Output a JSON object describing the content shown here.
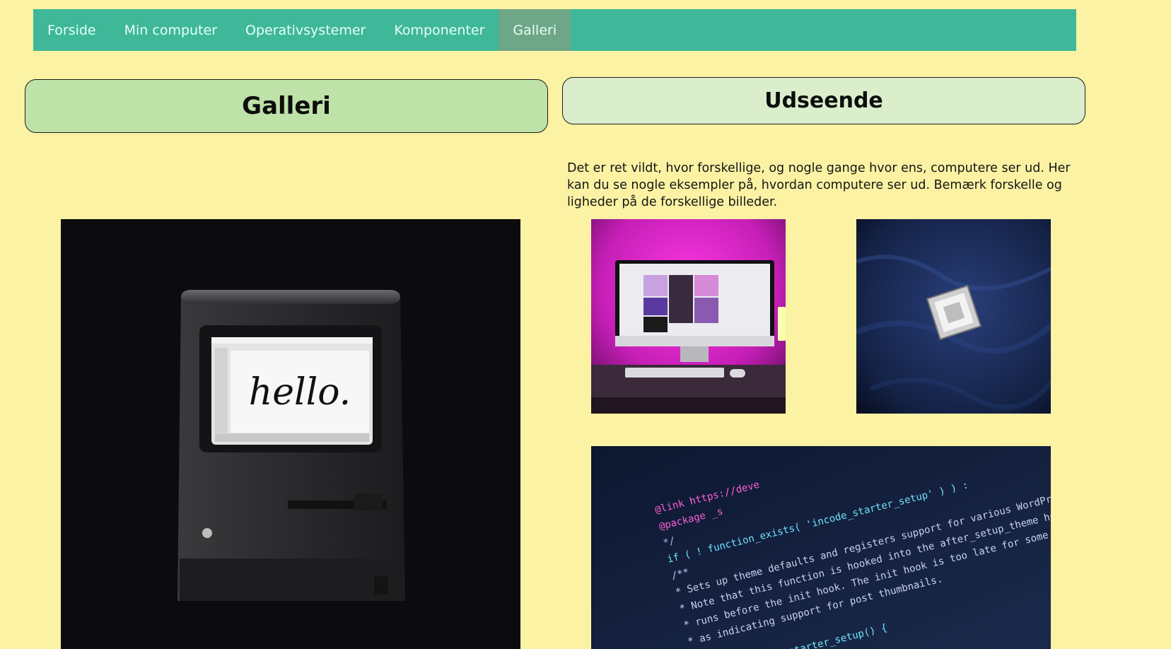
{
  "nav": {
    "items": [
      {
        "label": "Forside",
        "active": false
      },
      {
        "label": "Min computer",
        "active": false
      },
      {
        "label": "Operativsystemer",
        "active": false
      },
      {
        "label": "Komponenter",
        "active": false
      },
      {
        "label": "Galleri",
        "active": true
      }
    ]
  },
  "left_panel": {
    "title": "Galleri"
  },
  "right_panel": {
    "title": "Udseende",
    "intro": "Det er ret vildt, hvor forskellige, og nogle gange hvor ens, computere ser ud. Her kan du se nogle eksempler på, hvordan computere ser ud. Bemærk forskelle og ligheder på de forskellige billeder."
  },
  "gallery": {
    "mac_screen_text": "hello.",
    "code_lines": [
      "@link https://deve",
      "@package _s",
      "*/",
      "if ( ! function_exists( 'incode_starter_setup' ) ) :",
      "/**",
      " * Sets up theme defaults and registers support for various WordPress fe",
      " * Note that this function is hooked into the after_setup_theme hook, which",
      " * runs before the init hook. The init hook is too late for some features, s",
      " * as indicating support for post thumbnails.",
      " */",
      "function incode_starter_setup() {"
    ]
  },
  "colors": {
    "background": "#fbf2a4",
    "nav": "#3eb898",
    "nav_active": "#6ea788",
    "left_header": "#bee2a7",
    "right_header": "#daeecc"
  }
}
